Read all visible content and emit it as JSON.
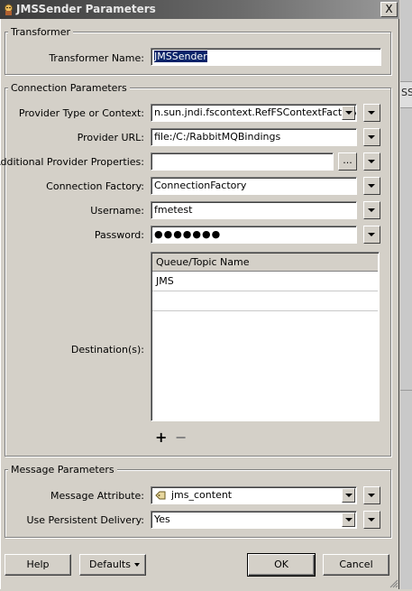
{
  "window": {
    "title": "JMSSender Parameters",
    "close_glyph": "X"
  },
  "backdrop": {
    "text": "SS"
  },
  "transformer": {
    "legend": "Transformer",
    "name_label": "Transformer Name:",
    "name_value": "JMSSender"
  },
  "connection": {
    "legend": "Connection Parameters",
    "provider_type_label": "Provider Type or Context:",
    "provider_type_value": "n.sun.jndi.fscontext.RefFSContextFactory",
    "provider_url_label": "Provider URL:",
    "provider_url_value": "file:/C:/RabbitMQBindings",
    "additional_label": "Additional Provider Properties:",
    "additional_value": "",
    "browse_label": "...",
    "factory_label": "Connection Factory:",
    "factory_value": "ConnectionFactory",
    "username_label": "Username:",
    "username_value": "fmetest",
    "password_label": "Password:",
    "password_value": "●●●●●●●",
    "destinations_label": "Destination(s):",
    "table_header": "Queue/Topic Name",
    "table_rows": [
      "JMS",
      ""
    ],
    "add_glyph": "+",
    "remove_glyph": "−"
  },
  "message": {
    "legend": "Message Parameters",
    "attribute_label": "Message Attribute:",
    "attribute_value": "jms_content",
    "persistent_label": "Use Persistent Delivery:",
    "persistent_value": "Yes"
  },
  "buttons": {
    "help": "Help",
    "defaults": "Defaults",
    "ok": "OK",
    "cancel": "Cancel"
  },
  "icons": {
    "app": "fme-app-icon",
    "attribute": "attribute-tag-icon"
  }
}
